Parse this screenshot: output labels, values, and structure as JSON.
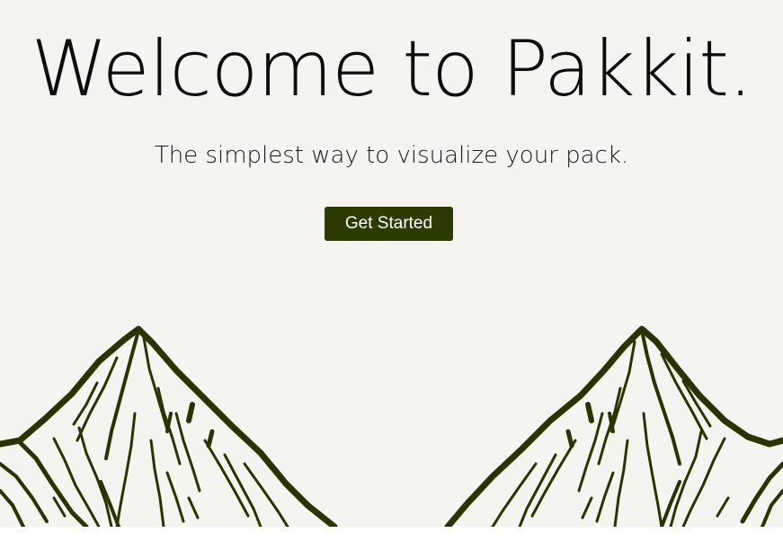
{
  "hero": {
    "title": "Welcome to Pakkit.",
    "subtitle": "The simplest way to visualize your pack.",
    "cta_label": "Get Started"
  },
  "colors": {
    "background": "#f5f4f0",
    "accent": "#2c3a03",
    "ink": "#2b3300"
  },
  "illustration": {
    "icon": "mountain-sketch-icon"
  }
}
